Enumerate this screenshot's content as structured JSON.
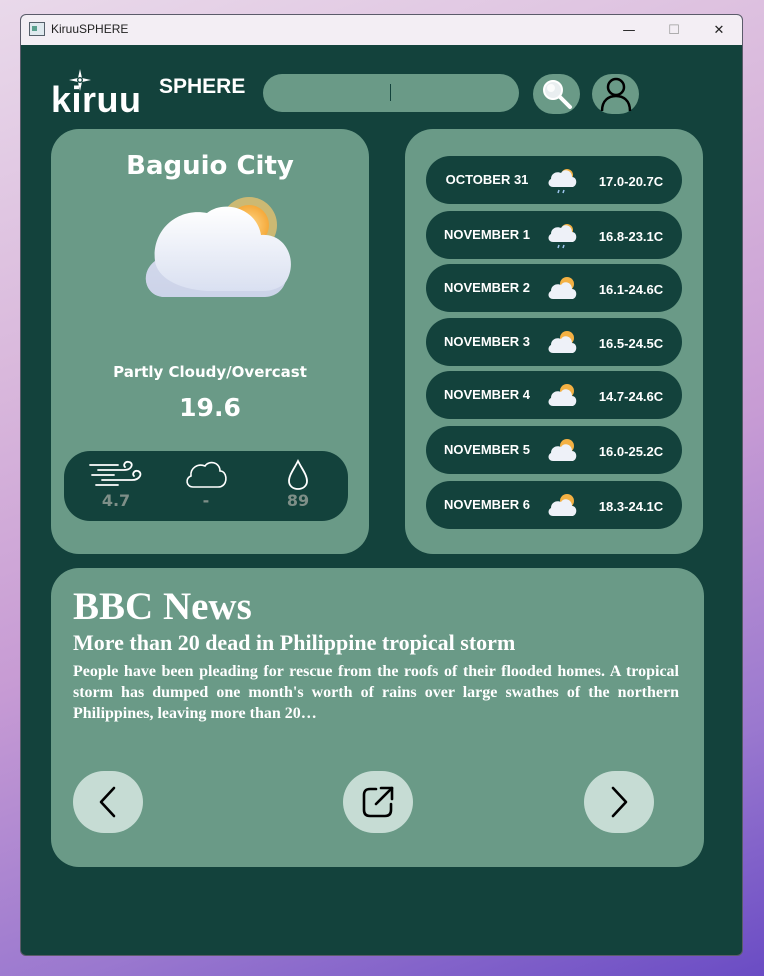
{
  "window": {
    "title": "KiruuSPHERE",
    "controls": {
      "minimize": "—",
      "maximize": "☐",
      "close": "✕"
    }
  },
  "header": {
    "logo_main": "kiruu",
    "logo_sup": "SPHERE",
    "search": {
      "value": "",
      "placeholder": ""
    },
    "search_button_icon": "magnifier-icon",
    "user_button_icon": "user-icon"
  },
  "current": {
    "city": "Baguio City",
    "icon": "partly-cloudy-icon",
    "condition": "Partly Cloudy/Overcast",
    "temperature": "19.6",
    "stats": {
      "wind": {
        "icon": "wind-icon",
        "value": "4.7"
      },
      "cloud": {
        "icon": "cloud-icon",
        "value": "-"
      },
      "humidity": {
        "icon": "droplet-icon",
        "value": "89"
      }
    }
  },
  "forecast": [
    {
      "date": "OCTOBER 31",
      "icon": "cloud-sun-rain-icon",
      "range": "17.0-20.7C"
    },
    {
      "date": "NOVEMBER 1",
      "icon": "cloud-sun-rain-icon",
      "range": "16.8-23.1C"
    },
    {
      "date": "NOVEMBER 2",
      "icon": "cloud-sun-icon",
      "range": "16.1-24.6C"
    },
    {
      "date": "NOVEMBER 3",
      "icon": "cloud-sun-icon",
      "range": "16.5-24.5C"
    },
    {
      "date": "NOVEMBER 4",
      "icon": "cloud-sun-icon",
      "range": "14.7-24.6C"
    },
    {
      "date": "NOVEMBER 5",
      "icon": "cloud-sun-icon",
      "range": "16.0-25.2C"
    },
    {
      "date": "NOVEMBER 6",
      "icon": "cloud-sun-icon",
      "range": "18.3-24.1C"
    }
  ],
  "news": {
    "source": "BBC News",
    "headline": "More than 20 dead in Philippine tropical storm",
    "summary": "People have been pleading for rescue from the roofs of their flooded homes. A tropical storm has dumped one month's worth of rains over large swathes of the northern Philippines, leaving more than 20…",
    "prev_icon": "chevron-left-icon",
    "open_icon": "external-link-icon",
    "next_icon": "chevron-right-icon"
  },
  "colors": {
    "background": "#13423c",
    "panel": "#6a9a87",
    "pill": "#13423c",
    "nav_button": "#c6dcd4",
    "stat_value": "#7e8f88"
  }
}
